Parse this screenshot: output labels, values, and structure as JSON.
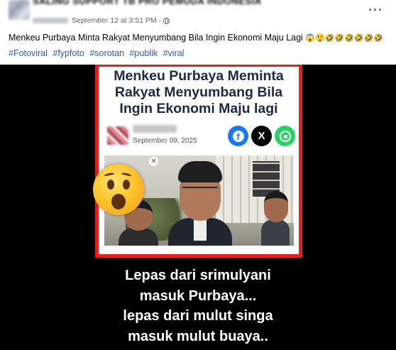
{
  "post": {
    "page_name": "SALING SUPPORT TB PRO PEMUDA INDONESIA",
    "date": "September 12 at 3:51 PM",
    "separator": "·",
    "caption": "Menkeu Purbaya Minta Rakyat Menyumbang Bila Ingin Ekonomi Maju Lagi",
    "caption_emojis": "😱😲🤣🤣🤣🤣🤣🤣",
    "hashtags": [
      "#Fotoviral",
      "#fypfoto",
      "#sorotan",
      "#publik",
      "#viral"
    ],
    "more_icon": "more-horizontal-icon"
  },
  "media": {
    "headline": [
      "Menkeu Purbaya Meminta",
      "Rakyat Menyumbang Bila",
      "Ingin Ekonomi Maju lagi"
    ],
    "article_date": "September 09, 2025",
    "share_icons": [
      "facebook-icon",
      "x-icon",
      "whatsapp-icon"
    ],
    "reaction_icon": "astonished-face-icon",
    "overlay_lines": [
      "Lepas dari srimulyani",
      "masuk Purbaya...",
      "lepas dari mulut singa",
      "masuk mulut buaya.."
    ],
    "colors": {
      "frame": "#e3201b",
      "headline": "#1c2a44",
      "facebook": "#1877f2",
      "whatsapp": "#25d366",
      "hashtag": "#385898"
    }
  }
}
